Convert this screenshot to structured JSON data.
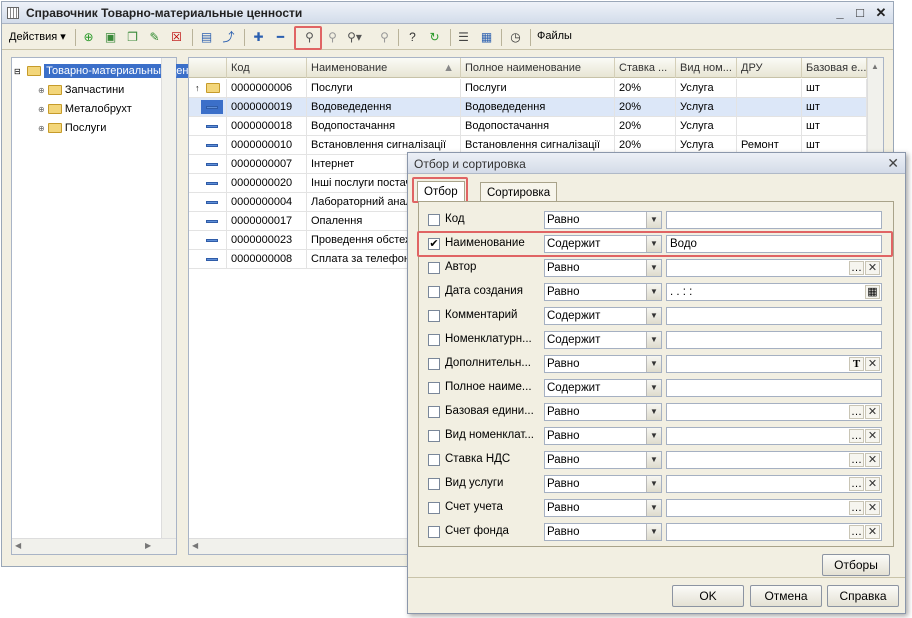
{
  "window": {
    "title": "Справочник Товарно-материальные ценности"
  },
  "toolbar": {
    "actions_label": "Действия",
    "files_label": "Файлы"
  },
  "tree": {
    "root": "Товарно-материальные ценности",
    "children": [
      "Запчастини",
      "Металобрухт",
      "Послуги"
    ]
  },
  "grid": {
    "columns": [
      "Код",
      "Наименование",
      "Полное наименование",
      "Ставка ...",
      "Вид ном...",
      "ДРУ",
      "Базовая е..."
    ],
    "rows": [
      {
        "code": "0000000006",
        "name": "Послуги",
        "full": "Послуги",
        "vat": "20%",
        "kind": "Услуга",
        "dru": "",
        "unit": "шт"
      },
      {
        "code": "0000000019",
        "name": "Водоведедення",
        "full": "Водоведедення",
        "vat": "20%",
        "kind": "Услуга",
        "dru": "",
        "unit": "шт"
      },
      {
        "code": "0000000018",
        "name": "Водопостачання",
        "full": "Водопостачання",
        "vat": "20%",
        "kind": "Услуга",
        "dru": "",
        "unit": "шт"
      },
      {
        "code": "0000000010",
        "name": "Встановлення сигналізації",
        "full": "Встановлення сигналізації",
        "vat": "20%",
        "kind": "Услуга",
        "dru": "Ремонт",
        "unit": "шт"
      },
      {
        "code": "0000000007",
        "name": "Інтернет",
        "full": "",
        "vat": "",
        "kind": "",
        "dru": "",
        "unit": ""
      },
      {
        "code": "0000000020",
        "name": "Інші послуги постач",
        "full": "",
        "vat": "",
        "kind": "",
        "dru": "",
        "unit": ""
      },
      {
        "code": "0000000004",
        "name": "Лабораторний анал",
        "full": "",
        "vat": "",
        "kind": "",
        "dru": "",
        "unit": ""
      },
      {
        "code": "0000000017",
        "name": "Опалення",
        "full": "",
        "vat": "",
        "kind": "",
        "dru": "",
        "unit": ""
      },
      {
        "code": "0000000023",
        "name": "Проведення обстеж",
        "full": "",
        "vat": "",
        "kind": "",
        "dru": "",
        "unit": ""
      },
      {
        "code": "0000000008",
        "name": "Сплата за телефон",
        "full": "",
        "vat": "",
        "kind": "",
        "dru": "",
        "unit": ""
      }
    ]
  },
  "dialog": {
    "title": "Отбор и сортировка",
    "tabs": [
      "Отбор",
      "Сортировка"
    ],
    "fields": [
      {
        "label": "Код",
        "checked": false,
        "op": "Равно",
        "value": "",
        "buttons": []
      },
      {
        "label": "Наименование",
        "checked": true,
        "op": "Содержит",
        "value": "Водо",
        "buttons": []
      },
      {
        "label": "Автор",
        "checked": false,
        "op": "Равно",
        "value": "",
        "buttons": [
          "...",
          "×"
        ]
      },
      {
        "label": "Дата создания",
        "checked": false,
        "op": "Равно",
        "value": " .  .      :  :",
        "buttons": [
          "calendar"
        ]
      },
      {
        "label": "Комментарий",
        "checked": false,
        "op": "Содержит",
        "value": "",
        "buttons": []
      },
      {
        "label": "Номенклатурн...",
        "checked": false,
        "op": "Содержит",
        "value": "",
        "buttons": []
      },
      {
        "label": "Дополнительн...",
        "checked": false,
        "op": "Равно",
        "value": "",
        "buttons": [
          "T",
          "×"
        ]
      },
      {
        "label": "Полное наиме...",
        "checked": false,
        "op": "Содержит",
        "value": "",
        "buttons": []
      },
      {
        "label": "Базовая едини...",
        "checked": false,
        "op": "Равно",
        "value": "",
        "buttons": [
          "...",
          "×"
        ]
      },
      {
        "label": "Вид номенклат...",
        "checked": false,
        "op": "Равно",
        "value": "",
        "buttons": [
          "...",
          "×"
        ]
      },
      {
        "label": "Ставка НДС",
        "checked": false,
        "op": "Равно",
        "value": "",
        "buttons": [
          "...",
          "×"
        ]
      },
      {
        "label": "Вид услуги",
        "checked": false,
        "op": "Равно",
        "value": "",
        "buttons": [
          "...",
          "×"
        ]
      },
      {
        "label": "Счет учета",
        "checked": false,
        "op": "Равно",
        "value": "",
        "buttons": [
          "...",
          "×"
        ]
      },
      {
        "label": "Счет фонда",
        "checked": false,
        "op": "Равно",
        "value": "",
        "buttons": [
          "...",
          "×"
        ]
      }
    ],
    "filters_button": "Отборы",
    "ok_button": "OK",
    "cancel_button": "Отмена",
    "help_button": "Справка"
  },
  "colors": {
    "highlight": "#e06464",
    "selected_row": "#dce7f8"
  }
}
